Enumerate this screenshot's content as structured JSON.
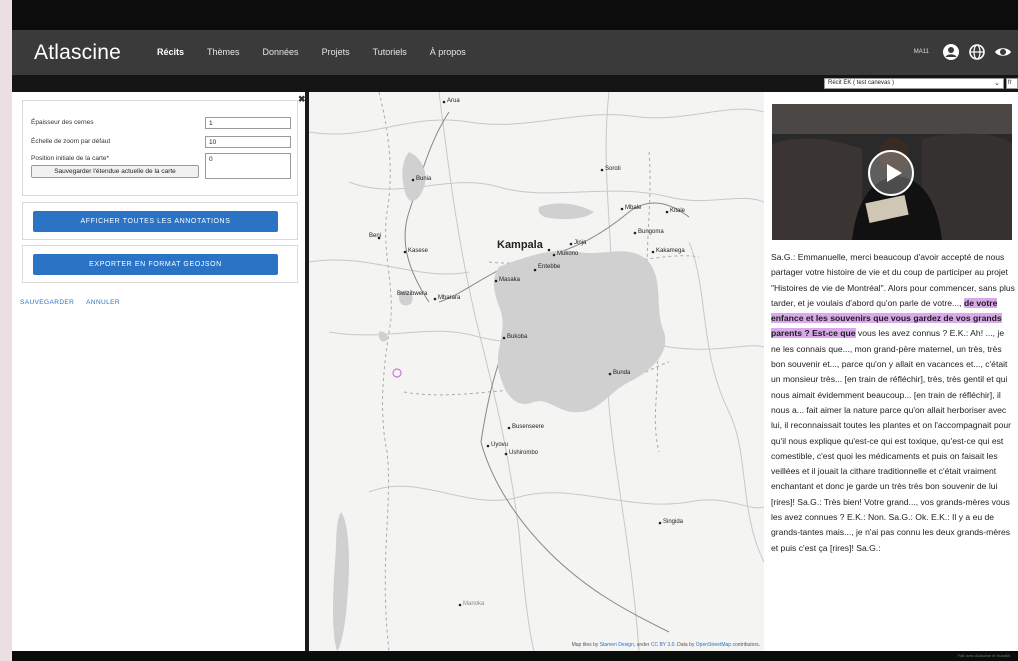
{
  "nav": {
    "brand": "Atlascine",
    "links": [
      "Récits",
      "Thèmes",
      "Données",
      "Projets",
      "Tutoriels",
      "À propos"
    ],
    "user": "MA11"
  },
  "subbar": {
    "recit_select": "Récit EK ( test canevas )",
    "lang_select": "fr"
  },
  "settings": {
    "epaisseur_label": "Épaisseur des cernes",
    "epaisseur_value": "1",
    "zoom_label": "Échelle de zoom par défaut",
    "zoom_value": "10",
    "position_label": "Position initiale de la carte*",
    "position_value": "0",
    "save_extent_label": "Sauvegarder l'étendue actuelle de la carte"
  },
  "buttons": {
    "show_annotations": "AFFICHER TOUTES LES ANNOTATIONS",
    "export_geojson": "EXPORTER EN FORMAT GEOJSON",
    "save": "SAUVEGARDER",
    "cancel": "ANNULER"
  },
  "map": {
    "cities": {
      "arua": "Arua",
      "bunia": "Bunia",
      "soroti": "Soroti",
      "mbale": "Mbale",
      "kitale": "Kitale",
      "beni": "Beni",
      "kasese": "Kasese",
      "kampala": "Kampala",
      "jinja": "Jinja",
      "mukono": "Mukono",
      "entebbe": "Entebbe",
      "bungoma": "Bungoma",
      "kakamega": "Kakamega",
      "bwizibwera": "Bwizibwera",
      "mbarara": "Mbarara",
      "masaka": "Masaka",
      "bukoba": "Bukoba",
      "bunda": "Bunda",
      "busenseere": "Busenseere",
      "uyovu": "Uyovu",
      "ushirombo": "Ushirombo",
      "singida": "Singida",
      "manoka": "Manoka"
    },
    "attribution_prefix": "Map tiles by",
    "attribution_stamen": "Stamen Design",
    "attribution_mid": ", under",
    "attribution_cc": "CC BY 3.0",
    "attribution_data": ". Data by",
    "attribution_osm": "OpenStreetMap",
    "attribution_suffix": "contributors."
  },
  "transcript": {
    "before": "Sa.G.: Emmanuelle, merci beaucoup d'avoir accepté de nous partager votre histoire de vie et du coup de participer au projet \"Histoires de vie de Montréal\". Alors pour commencer, sans plus tarder, et je voulais d'abord qu'on parle de votre...,",
    "highlight": "de votre enfance et les souvenirs que vous gardez de vos grands parents ? Est-ce que",
    "after": "vous les avez connus ? E.K.: Ah! ..., je ne les connais que..., mon grand-père maternel, un très, très bon souvenir et..., parce qu'on y allait en vacances et..., c'était un monsieur très... [en train de réfléchir], très, très gentil et qui nous aimait évidemment beaucoup... [en train de réfléchir], il nous a... fait aimer la nature parce qu'on allait herboriser avec lui, il reconnaissait toutes les plantes et on l'accompagnait pour qu'il nous explique qu'est-ce qui est toxique, qu'est-ce qui est comestible, c'est quoi les médicaments et puis on faisait les veillées et il jouait la cithare traditionnelle et c'était vraiment enchantant et donc je garde un très très bon souvenir de lui [rires]! Sa.G.: Très bien! Votre grand..., vos grands-mères vous les avez connues ? E.K.: Non. Sa.G.: Ok. E.K.: Il y a eu de grands-tantes mais..., je n'ai pas connu les deux grands-mères et puis c'est ça [rires]! Sa.G.:"
  },
  "footer": {
    "note": "Fait avec Atlascine et Nunaliit"
  },
  "colors": {
    "nav_bg": "#3a3a3a",
    "accent_blue": "#2a73c5",
    "highlight": "#d9a9ea",
    "lake": "#d0d0d0"
  }
}
